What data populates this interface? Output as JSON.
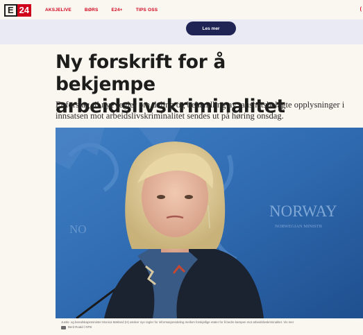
{
  "header": {
    "logo_e": "E",
    "logo_24": "24",
    "nav": [
      "AKSJELIVE",
      "BØRS",
      "E24+",
      "TIPS OSS"
    ],
    "nav_edge": "("
  },
  "promo": {
    "button_label": "Les mer"
  },
  "article": {
    "headline_line1": "Ny forskrift for å",
    "headline_line2": "bekjempe arbeidslivskriminalitet",
    "lead": "Et forslag til nye regler om deling og behandling av taushetsbelagte opplysninger i innsatsen mot arbeidslivskriminalitet sendes ut på høring onsdag.",
    "photo_text_1": "NORWAY",
    "photo_text_2": "NORWEGIAN MINISTR",
    "photo_text_left": "NO",
    "caption": "Justis- og beredskapsminister Monica Mæland (H) ønsker nye regler for informasjonsdeling mellom forskjellige etater for å bedre kampen mot arbeidslivskriminalitet.   Vis mer",
    "credit": "Berit Roald / NTB"
  },
  "colors": {
    "brand_red": "#d0021b",
    "button_navy": "#1f2455",
    "page_bg": "#faf6f0",
    "photo_blue": "#2f6ab0"
  }
}
